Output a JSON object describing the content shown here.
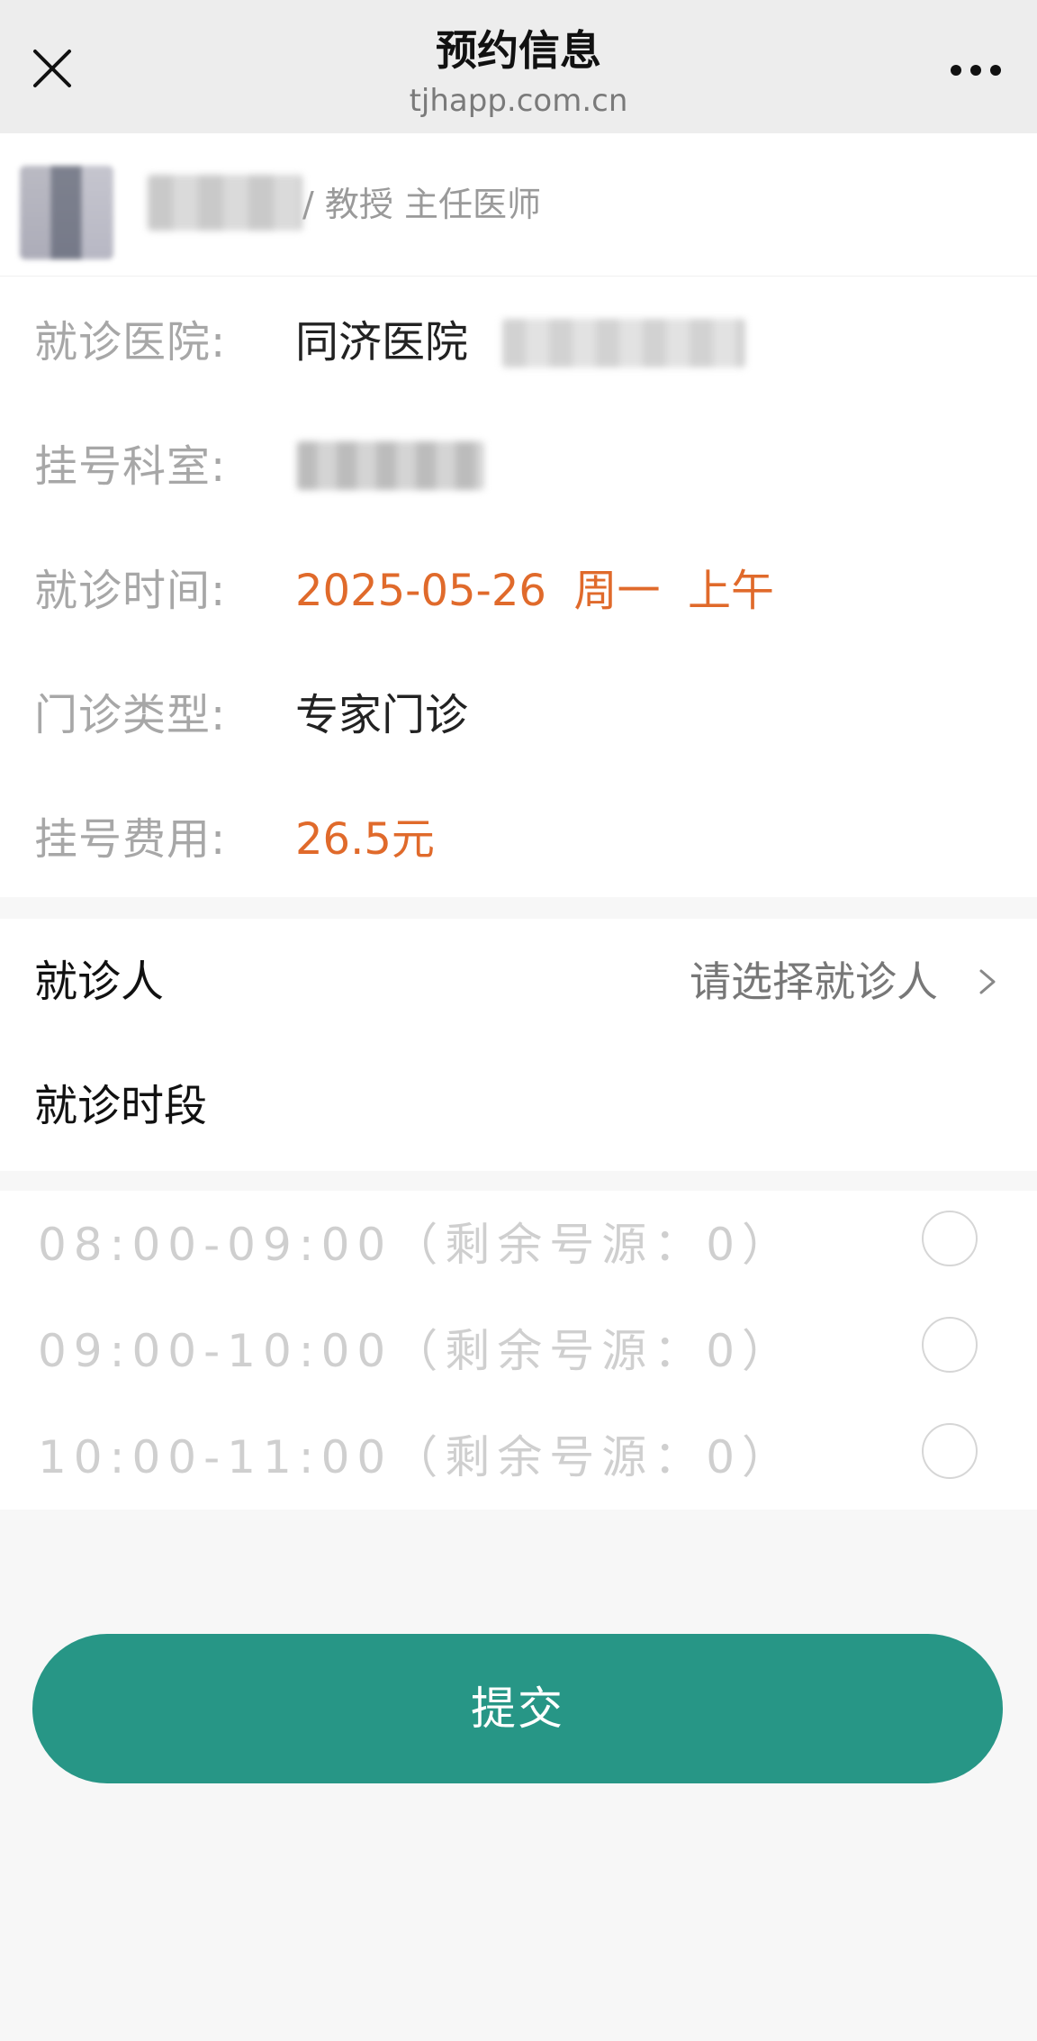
{
  "titlebar": {
    "title": "预约信息",
    "domain": "tjhapp.com.cn"
  },
  "doctor": {
    "title": "/ 教授 主任医师"
  },
  "info": {
    "hospital_label": "就诊医院:",
    "hospital_value": "同济医院",
    "department_label": "挂号科室:",
    "time_label": "就诊时间:",
    "time_value": "2025-05-26  周一  上午",
    "type_label": "门诊类型:",
    "type_value": "专家门诊",
    "fee_label": "挂号费用:",
    "fee_value": "26.5元"
  },
  "patient": {
    "label": "就诊人",
    "placeholder": "请选择就诊人"
  },
  "slots": {
    "header": "就诊时段",
    "items": [
      {
        "text": "08:00-09:00（剩余号源：0）"
      },
      {
        "text": "09:00-10:00（剩余号源：0）"
      },
      {
        "text": "10:00-11:00（剩余号源：0）"
      }
    ]
  },
  "submit": {
    "label": "提交"
  },
  "colors": {
    "accent": "#279686",
    "highlight": "#e06a2b"
  }
}
